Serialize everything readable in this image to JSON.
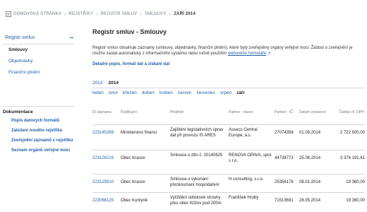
{
  "breadcrumb": [
    "DOMOVSKÁ STRÁNKA",
    "REJSTŘÍKY",
    "REGISTR SMLUV",
    "SMLOUVY",
    "ZÁŘÍ 2014"
  ],
  "sidebar": {
    "group_title": "Registr smluv",
    "items": [
      {
        "label": "Smlouvy",
        "active": true
      },
      {
        "label": "Objednávky",
        "active": false
      },
      {
        "label": "Finanční plnění",
        "active": false
      }
    ],
    "doc_title": "Dokumentace",
    "doc_links": [
      "Popis datových formátů",
      "Založení nového rejstříku",
      "Zveřejnění záznamů v rejstříku",
      "Seznam orgánů veřejné moci"
    ]
  },
  "main": {
    "title": "Registr smluv - Smlouvy",
    "intro_text": "Registr smluv obsahuje záznamy (smlouvy, objednávky, finanční plnění), které byly zveřejněny orgány veřejné moci. Žádost o zveřejnění je možno zaslat automaticky z informačního systému nebo ručně použitím ",
    "intro_link": "webového formuláře",
    "detail_link": "Detailní popis, formát dat a získání dat",
    "years": [
      {
        "label": "2013",
        "active": false
      },
      {
        "label": "2014",
        "active": true
      }
    ],
    "months": [
      {
        "label": "leden",
        "active": false
      },
      {
        "label": "únor",
        "active": false
      },
      {
        "label": "březen",
        "active": false
      },
      {
        "label": "duben",
        "active": false
      },
      {
        "label": "květen",
        "active": false
      },
      {
        "label": "červen",
        "active": false
      },
      {
        "label": "červenec",
        "active": false
      },
      {
        "label": "srpen",
        "active": false
      },
      {
        "label": "září",
        "active": true
      }
    ],
    "table": {
      "headers": [
        "ID záznamu:",
        "Publikující:",
        "Předmět:",
        "Partner - název:",
        "Partner - IČ:",
        "Datum vystavení:",
        "Částka vč. DPH:"
      ],
      "rows": [
        [
          "223145269",
          "Ministerstvo financí",
          "Zajištění legislativních úprav dat při provozu IS ARES",
          "Asseco Central Europe, a.s.",
          "27074358",
          "01.09.2014",
          "2 722 500,00"
        ],
        [
          "223126219",
          "Obec Krasov",
          "Smlouva o dílo č. 20140825",
          "RENOVA OPAVA, spol. s r.o.",
          "44738773",
          "25.08.2014",
          "3 376 191,61"
        ],
        [
          "223125910",
          "Obec Krasov",
          "Smlouva o vykonání přezkoumání hospodaření",
          "H consulting, s.r.o.",
          "25356178",
          "08.01.2014",
          "19 360,00"
        ],
        [
          "223066125",
          "Obec Korkyně",
          "Vyčištění odtokové strouhy přes obec Klížov pod 200m",
          "František Hrubý",
          "71513691",
          "28.05.2014",
          "19 360,00"
        ]
      ]
    }
  }
}
